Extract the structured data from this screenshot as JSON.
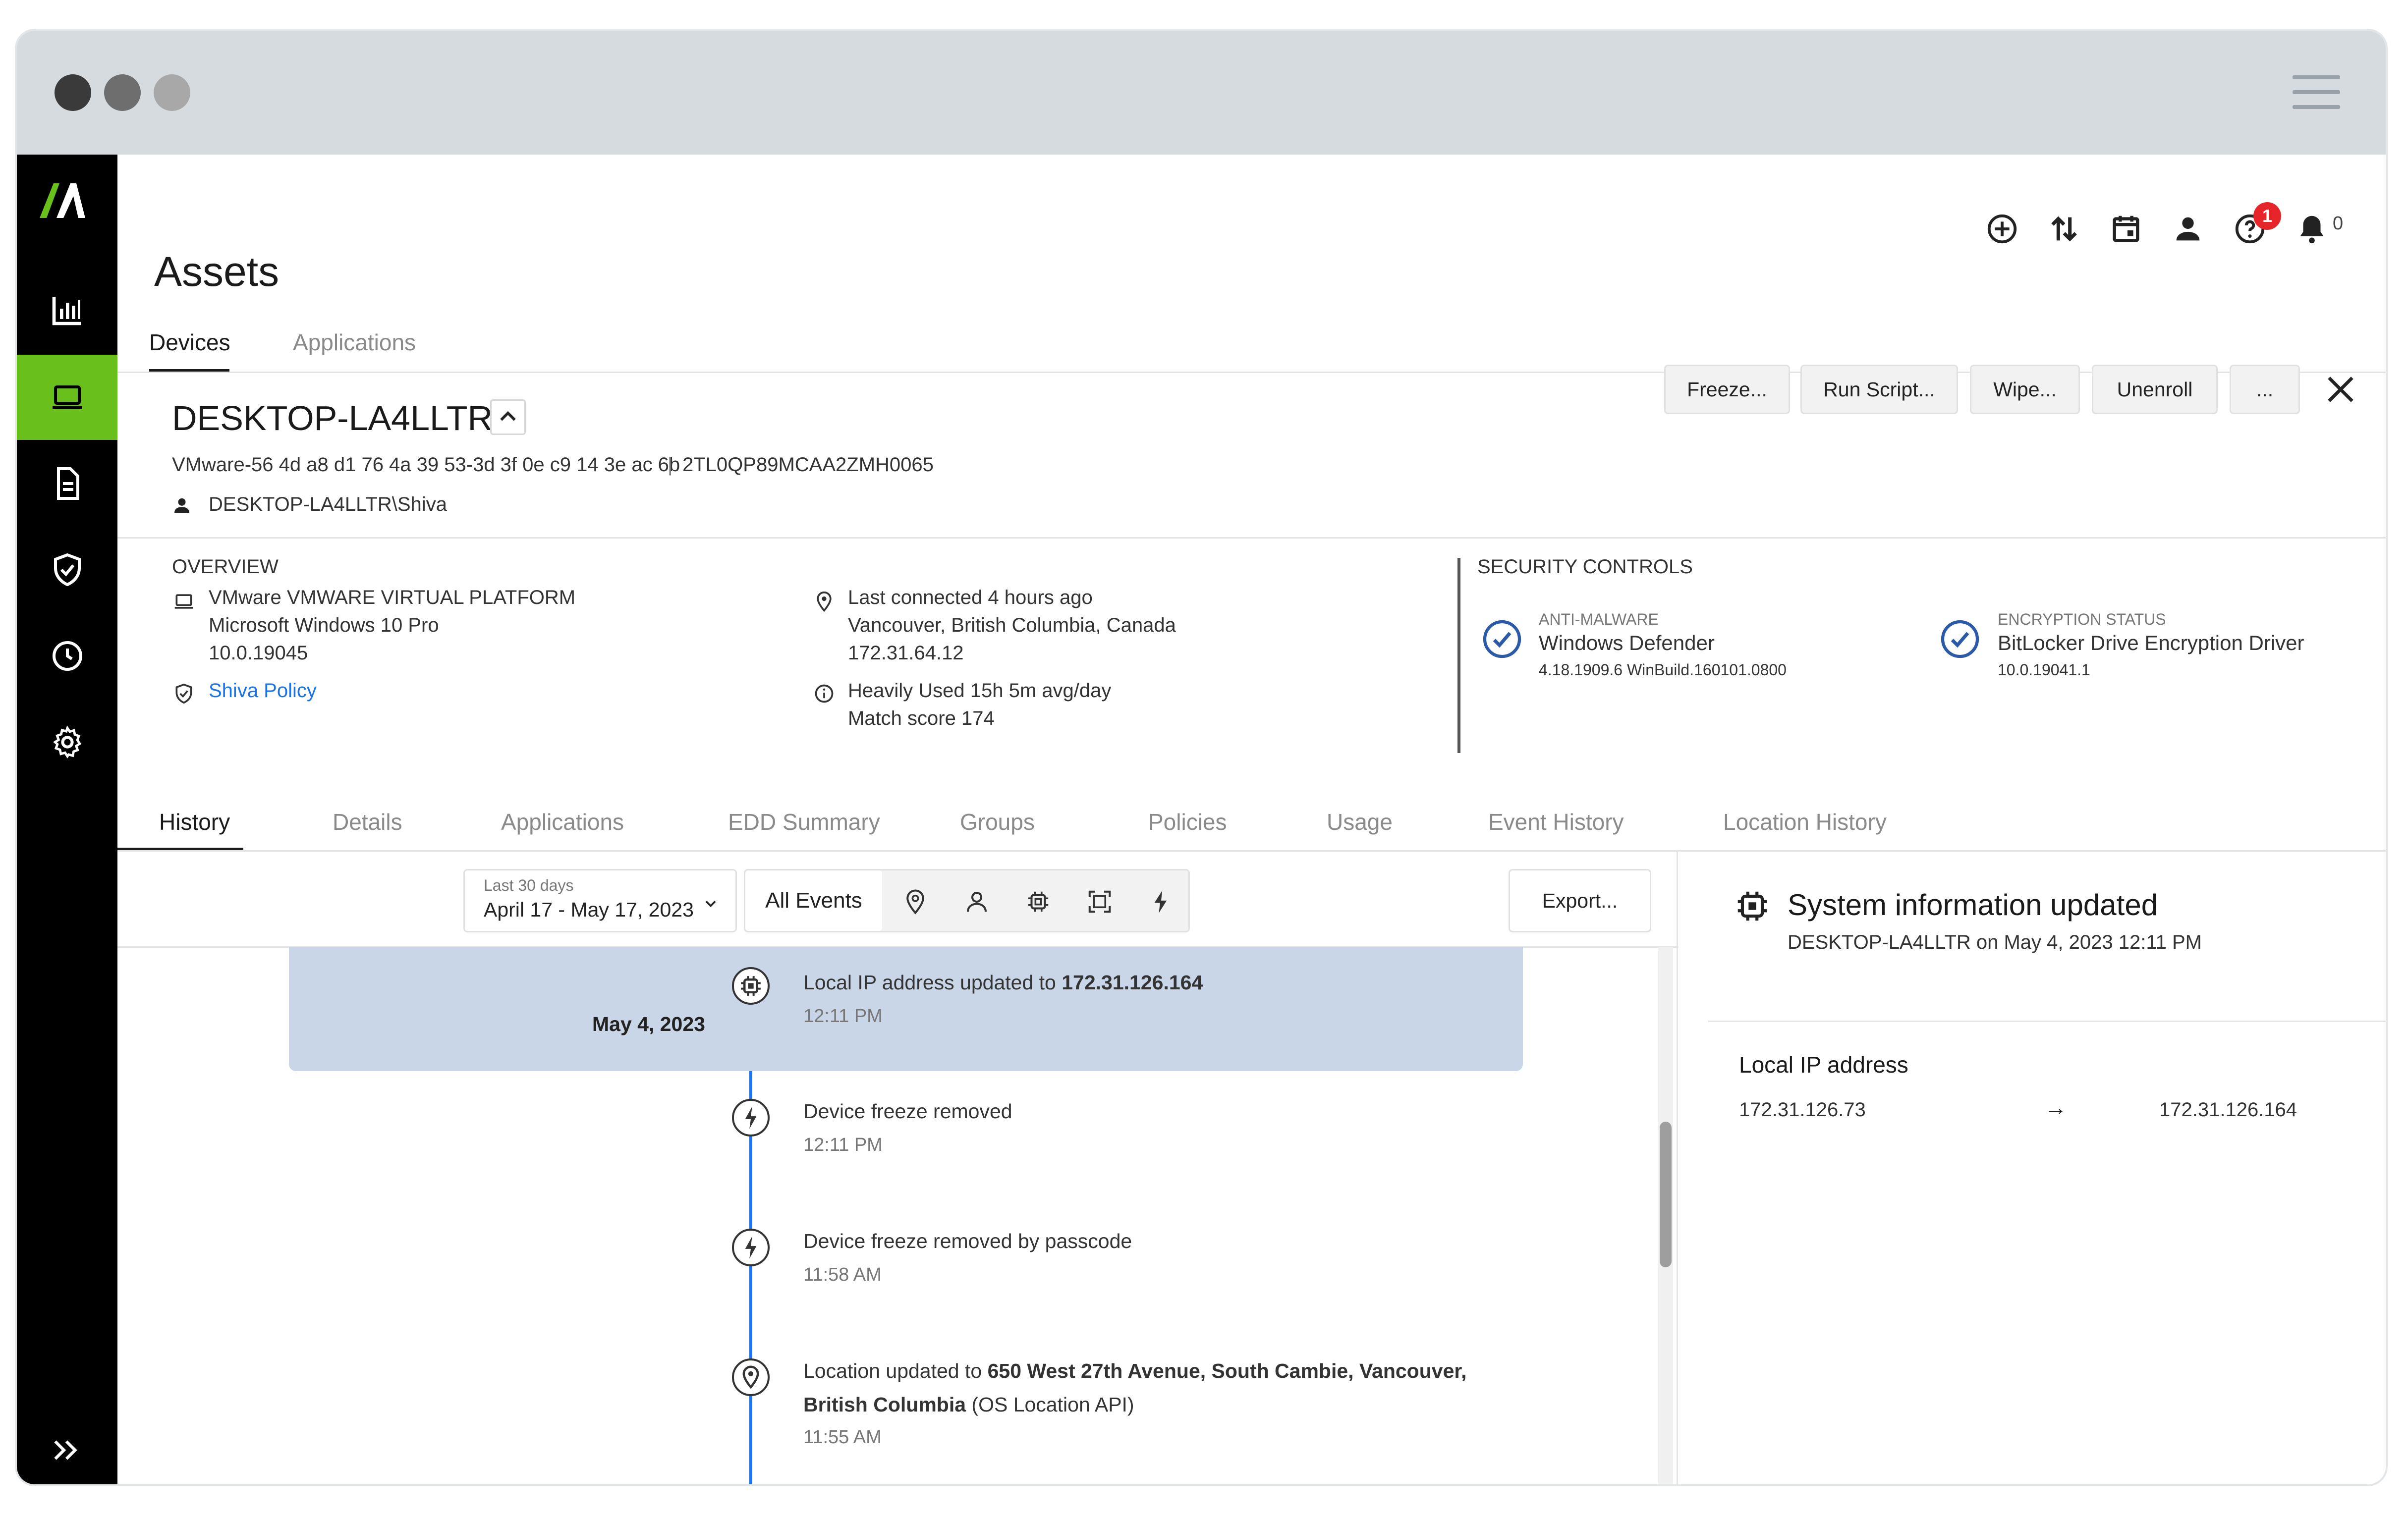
{
  "colors": {
    "accent_green": "#6ac01a",
    "link_blue": "#1a73e8",
    "timeline_blue": "#1a73e8",
    "selected_row_bg": "#c8d6e8",
    "badge_red": "#e5252a"
  },
  "header": {
    "title": "Assets",
    "tabs": [
      "Devices",
      "Applications"
    ],
    "icons": [
      "add-circle-icon",
      "transfer-icon",
      "calendar-icon",
      "user-icon",
      "help-icon",
      "bell-icon"
    ],
    "help_badge": "1",
    "notification_count": "0"
  },
  "device": {
    "name": "DESKTOP-LA4LLTR",
    "serial": "VMware-56 4d a8 d1 76 4a 39 53-3d 3f 0e c9 14 3e ac 6b",
    "separator": "|",
    "asset_id": "2TL0QP89MCAA2ZMH0065",
    "user": "DESKTOP-LA4LLTR\\Shiva",
    "actions": [
      "Freeze...",
      "Run Script...",
      "Wipe...",
      "Unenroll",
      "..."
    ]
  },
  "overview": {
    "heading": "OVERVIEW",
    "platform": "VMware VMWARE VIRTUAL PLATFORM",
    "os": "Microsoft Windows 10 Pro",
    "os_version": "10.0.19045",
    "policy": "Shiva Policy",
    "last_connected": "Last connected 4 hours ago",
    "location": "Vancouver, British Columbia, Canada",
    "ip": "172.31.64.12",
    "usage": "Heavily Used 15h 5m avg/day",
    "match_score": "Match score 174"
  },
  "security": {
    "heading": "SECURITY CONTROLS",
    "anti_malware_label": "ANTI-MALWARE",
    "anti_malware_name": "Windows Defender",
    "anti_malware_version": "4.18.1909.6 WinBuild.160101.0800",
    "encryption_label": "ENCRYPTION STATUS",
    "encryption_name": "BitLocker Drive Encryption Driver",
    "encryption_version": "10.0.19041.1"
  },
  "detail_tabs": [
    "History",
    "Details",
    "Applications",
    "EDD Summary",
    "Groups",
    "Policies",
    "Usage",
    "Event History",
    "Location History"
  ],
  "filters": {
    "range_label": "Last 30 days",
    "range_value": "April 17 - May 17, 2023",
    "events_label": "All Events",
    "export_label": "Export..."
  },
  "timeline": {
    "date": "May 4, 2023",
    "events": [
      {
        "icon": "chip-icon",
        "text": "Local IP address updated to ",
        "bold": "172.31.126.164",
        "time": "12:11 PM"
      },
      {
        "icon": "bolt-icon",
        "text": "Device freeze removed",
        "time": "12:11 PM"
      },
      {
        "icon": "bolt-icon",
        "text": "Device freeze removed by passcode",
        "time": "11:58 AM"
      },
      {
        "icon": "location-pin-icon",
        "text": "Location updated to ",
        "bold": "650 West 27th Avenue, South Cambie, Vancouver,",
        "bold2": "British Columbia",
        "suffix": " (OS Location API)",
        "time": "11:55 AM"
      }
    ]
  },
  "detail_panel": {
    "title": "System information updated",
    "subtitle": "DESKTOP-LA4LLTR on May 4, 2023 12:11 PM",
    "field": "Local IP address",
    "old_value": "172.31.126.73",
    "arrow": "→",
    "new_value": "172.31.126.164"
  }
}
